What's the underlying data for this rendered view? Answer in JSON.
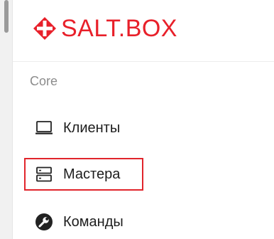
{
  "brand": {
    "name": "SALT.BOX",
    "logo_icon": "saltbox-diamond-icon",
    "accent_color": "#e8202a"
  },
  "sidebar": {
    "section_label": "Core",
    "items": [
      {
        "label": "Клиенты",
        "icon": "laptop-icon",
        "selected": false
      },
      {
        "label": "Мастера",
        "icon": "server-icon",
        "selected": true
      },
      {
        "label": "Команды",
        "icon": "wrench-icon",
        "selected": false
      }
    ],
    "highlight_color": "#e1252c"
  }
}
